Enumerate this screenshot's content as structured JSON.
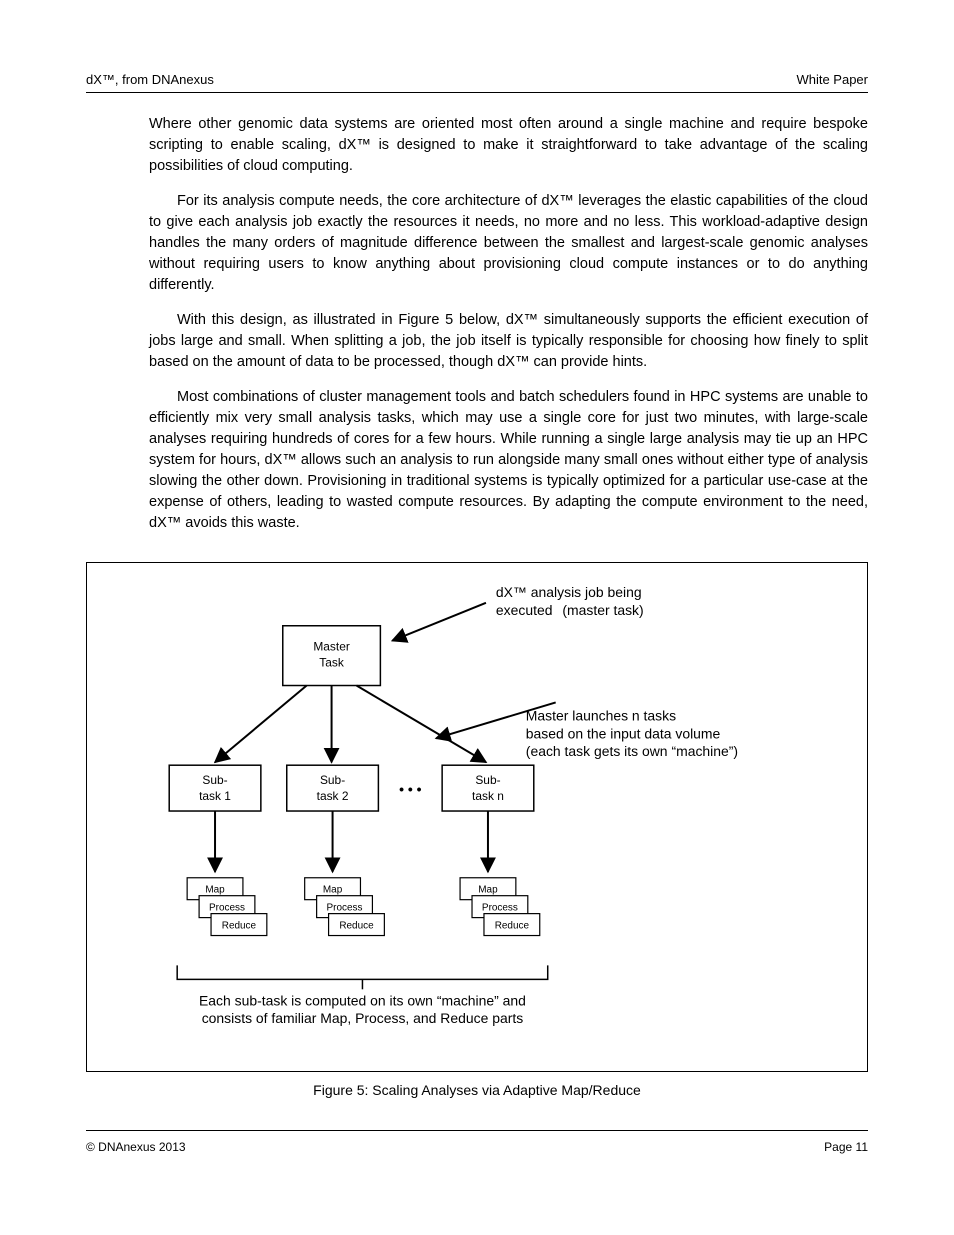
{
  "header": {
    "left": "dX™, from DNAnexus",
    "right": "White Paper"
  },
  "paragraphs": {
    "p1": "Where other genomic data systems are oriented most often around a single machine and require bespoke scripting to enable scaling, dX™ is designed to make it straightforward to take advantage of the scaling possibilities of cloud computing.",
    "p2": "For its analysis compute needs, the core architecture of dX™ leverages the elastic capabilities of the cloud to give each analysis job exactly the resources it needs, no more and no less. This workload-adaptive design handles the many orders of magnitude difference between the smallest and largest-scale genomic analyses without requiring users to know anything about provisioning cloud compute instances or to do anything differently.",
    "p3": "With this design, as illustrated in Figure 5 below, dX™ simultaneously supports the efficient execution of jobs large and small. When splitting a job, the job itself is typically responsible for choosing how finely to split based on the amount of data to be processed, though dX™ can provide hints.",
    "p4": "Most combinations of cluster management tools and batch schedulers found in HPC systems are unable to efficiently mix very small analysis tasks, which may use a single core for just two minutes, with large-scale analyses requiring hundreds of cores for a few hours. While running a single large analysis may tie up an HPC system for hours, dX™ allows such an analysis to run alongside many small ones without either type of analysis slowing the other down. Provisioning in traditional systems is typically optimized for a particular use-case at the expense of others, leading to wasted compute resources. By adapting the compute environment to the need, dX™ avoids this waste."
  },
  "figure": {
    "topLabel1": "dX™ analysis job being",
    "topLabel2": "executed",
    "topLabel2b": "(master task)",
    "midLabel1": "Master launches n tasks",
    "midLabel2": "based on the input data volume",
    "midLabel3": "(each task gets its own ",
    "midLabel3q": "“machine”",
    "midLabel3tail": ")",
    "subTop": "Sub-",
    "subBot1": "task 1",
    "subBot2": "task 2",
    "subBotN": "task n",
    "rowA": "Map",
    "rowB": "Process",
    "rowC": "Reduce",
    "bracket1": "Each sub-task is computed on its own ",
    "bracket1q": "“machine”",
    "bracket1tail": " and",
    "bracket2": "consists of familiar Map, Process, and Reduce parts",
    "dots": "• • •",
    "caption": "Figure 5: Scaling Analyses via Adaptive Map/Reduce"
  },
  "footer": {
    "left": "© DNAnexus 2013",
    "right": "Page 11"
  }
}
